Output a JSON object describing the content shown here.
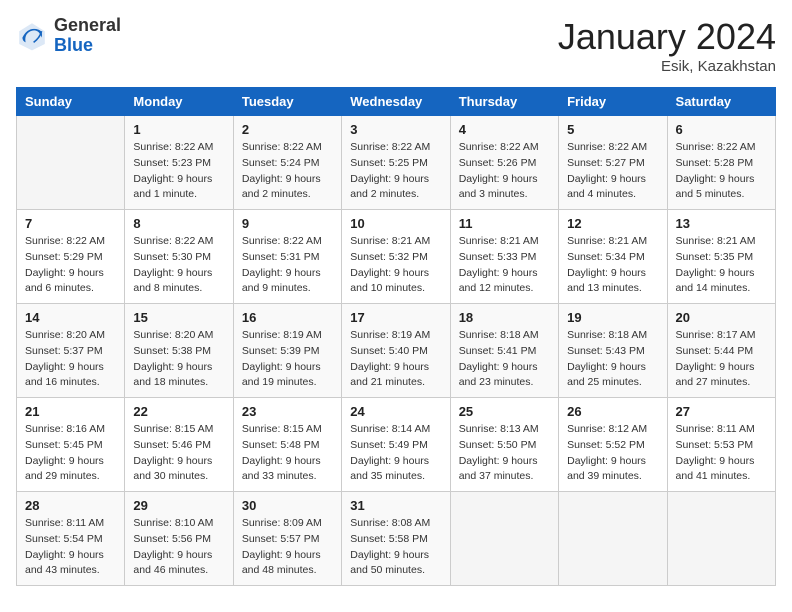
{
  "header": {
    "logo_general": "General",
    "logo_blue": "Blue",
    "month_title": "January 2024",
    "subtitle": "Esik, Kazakhstan"
  },
  "weekdays": [
    "Sunday",
    "Monday",
    "Tuesday",
    "Wednesday",
    "Thursday",
    "Friday",
    "Saturday"
  ],
  "rows": [
    [
      {
        "day": "",
        "empty": true
      },
      {
        "day": "1",
        "sunrise": "Sunrise: 8:22 AM",
        "sunset": "Sunset: 5:23 PM",
        "daylight": "Daylight: 9 hours and 1 minute."
      },
      {
        "day": "2",
        "sunrise": "Sunrise: 8:22 AM",
        "sunset": "Sunset: 5:24 PM",
        "daylight": "Daylight: 9 hours and 2 minutes."
      },
      {
        "day": "3",
        "sunrise": "Sunrise: 8:22 AM",
        "sunset": "Sunset: 5:25 PM",
        "daylight": "Daylight: 9 hours and 2 minutes."
      },
      {
        "day": "4",
        "sunrise": "Sunrise: 8:22 AM",
        "sunset": "Sunset: 5:26 PM",
        "daylight": "Daylight: 9 hours and 3 minutes."
      },
      {
        "day": "5",
        "sunrise": "Sunrise: 8:22 AM",
        "sunset": "Sunset: 5:27 PM",
        "daylight": "Daylight: 9 hours and 4 minutes."
      },
      {
        "day": "6",
        "sunrise": "Sunrise: 8:22 AM",
        "sunset": "Sunset: 5:28 PM",
        "daylight": "Daylight: 9 hours and 5 minutes."
      }
    ],
    [
      {
        "day": "7",
        "sunrise": "Sunrise: 8:22 AM",
        "sunset": "Sunset: 5:29 PM",
        "daylight": "Daylight: 9 hours and 6 minutes."
      },
      {
        "day": "8",
        "sunrise": "Sunrise: 8:22 AM",
        "sunset": "Sunset: 5:30 PM",
        "daylight": "Daylight: 9 hours and 8 minutes."
      },
      {
        "day": "9",
        "sunrise": "Sunrise: 8:22 AM",
        "sunset": "Sunset: 5:31 PM",
        "daylight": "Daylight: 9 hours and 9 minutes."
      },
      {
        "day": "10",
        "sunrise": "Sunrise: 8:21 AM",
        "sunset": "Sunset: 5:32 PM",
        "daylight": "Daylight: 9 hours and 10 minutes."
      },
      {
        "day": "11",
        "sunrise": "Sunrise: 8:21 AM",
        "sunset": "Sunset: 5:33 PM",
        "daylight": "Daylight: 9 hours and 12 minutes."
      },
      {
        "day": "12",
        "sunrise": "Sunrise: 8:21 AM",
        "sunset": "Sunset: 5:34 PM",
        "daylight": "Daylight: 9 hours and 13 minutes."
      },
      {
        "day": "13",
        "sunrise": "Sunrise: 8:21 AM",
        "sunset": "Sunset: 5:35 PM",
        "daylight": "Daylight: 9 hours and 14 minutes."
      }
    ],
    [
      {
        "day": "14",
        "sunrise": "Sunrise: 8:20 AM",
        "sunset": "Sunset: 5:37 PM",
        "daylight": "Daylight: 9 hours and 16 minutes."
      },
      {
        "day": "15",
        "sunrise": "Sunrise: 8:20 AM",
        "sunset": "Sunset: 5:38 PM",
        "daylight": "Daylight: 9 hours and 18 minutes."
      },
      {
        "day": "16",
        "sunrise": "Sunrise: 8:19 AM",
        "sunset": "Sunset: 5:39 PM",
        "daylight": "Daylight: 9 hours and 19 minutes."
      },
      {
        "day": "17",
        "sunrise": "Sunrise: 8:19 AM",
        "sunset": "Sunset: 5:40 PM",
        "daylight": "Daylight: 9 hours and 21 minutes."
      },
      {
        "day": "18",
        "sunrise": "Sunrise: 8:18 AM",
        "sunset": "Sunset: 5:41 PM",
        "daylight": "Daylight: 9 hours and 23 minutes."
      },
      {
        "day": "19",
        "sunrise": "Sunrise: 8:18 AM",
        "sunset": "Sunset: 5:43 PM",
        "daylight": "Daylight: 9 hours and 25 minutes."
      },
      {
        "day": "20",
        "sunrise": "Sunrise: 8:17 AM",
        "sunset": "Sunset: 5:44 PM",
        "daylight": "Daylight: 9 hours and 27 minutes."
      }
    ],
    [
      {
        "day": "21",
        "sunrise": "Sunrise: 8:16 AM",
        "sunset": "Sunset: 5:45 PM",
        "daylight": "Daylight: 9 hours and 29 minutes."
      },
      {
        "day": "22",
        "sunrise": "Sunrise: 8:15 AM",
        "sunset": "Sunset: 5:46 PM",
        "daylight": "Daylight: 9 hours and 30 minutes."
      },
      {
        "day": "23",
        "sunrise": "Sunrise: 8:15 AM",
        "sunset": "Sunset: 5:48 PM",
        "daylight": "Daylight: 9 hours and 33 minutes."
      },
      {
        "day": "24",
        "sunrise": "Sunrise: 8:14 AM",
        "sunset": "Sunset: 5:49 PM",
        "daylight": "Daylight: 9 hours and 35 minutes."
      },
      {
        "day": "25",
        "sunrise": "Sunrise: 8:13 AM",
        "sunset": "Sunset: 5:50 PM",
        "daylight": "Daylight: 9 hours and 37 minutes."
      },
      {
        "day": "26",
        "sunrise": "Sunrise: 8:12 AM",
        "sunset": "Sunset: 5:52 PM",
        "daylight": "Daylight: 9 hours and 39 minutes."
      },
      {
        "day": "27",
        "sunrise": "Sunrise: 8:11 AM",
        "sunset": "Sunset: 5:53 PM",
        "daylight": "Daylight: 9 hours and 41 minutes."
      }
    ],
    [
      {
        "day": "28",
        "sunrise": "Sunrise: 8:11 AM",
        "sunset": "Sunset: 5:54 PM",
        "daylight": "Daylight: 9 hours and 43 minutes."
      },
      {
        "day": "29",
        "sunrise": "Sunrise: 8:10 AM",
        "sunset": "Sunset: 5:56 PM",
        "daylight": "Daylight: 9 hours and 46 minutes."
      },
      {
        "day": "30",
        "sunrise": "Sunrise: 8:09 AM",
        "sunset": "Sunset: 5:57 PM",
        "daylight": "Daylight: 9 hours and 48 minutes."
      },
      {
        "day": "31",
        "sunrise": "Sunrise: 8:08 AM",
        "sunset": "Sunset: 5:58 PM",
        "daylight": "Daylight: 9 hours and 50 minutes."
      },
      {
        "day": "",
        "empty": true
      },
      {
        "day": "",
        "empty": true
      },
      {
        "day": "",
        "empty": true
      }
    ]
  ]
}
